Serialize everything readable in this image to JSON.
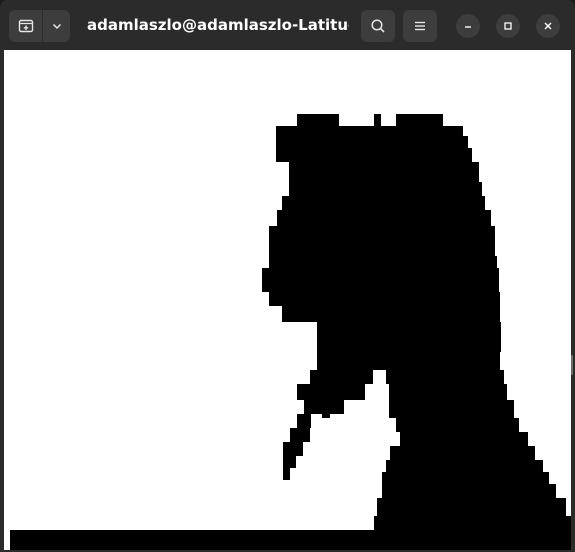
{
  "window": {
    "title": "adamlaszlo@adamlaszlo-Latitude-..."
  },
  "icons": {
    "new_tab": "new-tab-icon",
    "dropdown": "chevron-down-icon",
    "search": "search-icon",
    "menu": "hamburger-menu-icon",
    "minimize": "minimize-icon",
    "maximize": "maximize-icon",
    "close": "close-icon"
  },
  "terminal": {
    "content": "ASCII/pixel silhouette rendering of a profile portrait in black on white"
  },
  "colors": {
    "titlebar": "#2b2b2b",
    "button": "#3d3d3d",
    "foreground": "#000000",
    "background": "#ffffff"
  }
}
